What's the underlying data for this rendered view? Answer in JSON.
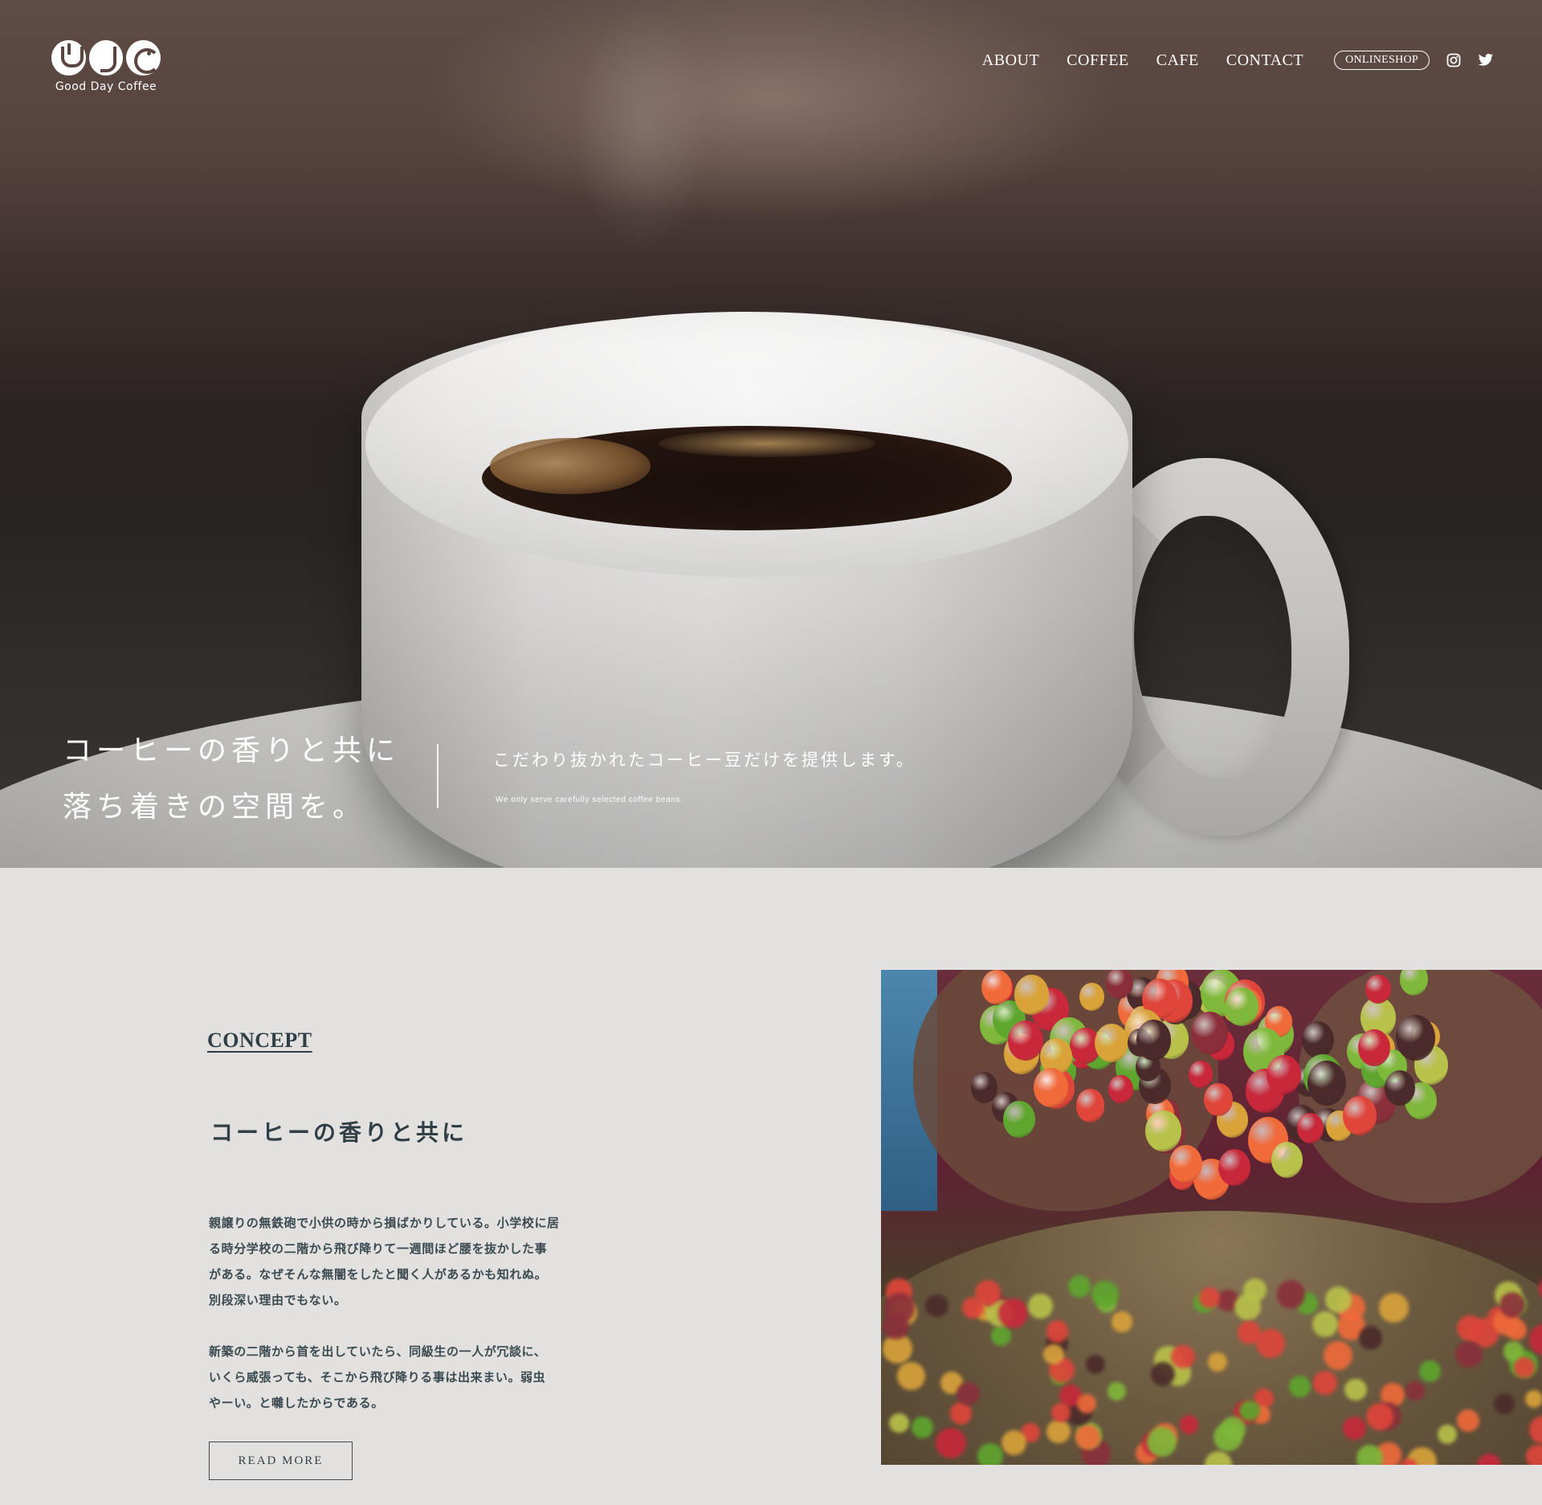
{
  "brand": {
    "name": "Good Day Coffee"
  },
  "nav": {
    "links": [
      "ABOUT",
      "COFFEE",
      "CAFE",
      "CONTACT"
    ],
    "shop_label": "ONLINESHOP",
    "icons": [
      "instagram-icon",
      "twitter-icon"
    ]
  },
  "hero": {
    "title_lines": [
      "コーヒーの香りと共に",
      "落ち着きの空間を。"
    ],
    "subtitle": "こだわり抜かれたコーヒー豆だけを提供します。",
    "subtitle_en": "We only serve carefully selected coffee beans."
  },
  "concept": {
    "label": "CONCEPT",
    "heading": "コーヒーの香りと共に",
    "paragraphs": [
      [
        "親譲りの無鉄砲で小供の時から損ばかりしている。小学校に居",
        "る時分学校の二階から飛び降りて一週間ほど腰を抜かした事",
        "がある。なぜそんな無闇をしたと聞く人があるかも知れぬ。",
        "別段深い理由でもない。"
      ],
      [
        "新築の二階から首を出していたら、同級生の一人が冗談に、",
        "いくら威張っても、そこから飛び降りる事は出来まい。弱虫",
        "やーい。と囃したからである。"
      ]
    ],
    "read_more": "READ MORE"
  },
  "colors": {
    "background": "#e3e1df",
    "text": "#2f3f45",
    "hero_text": "#ffffff"
  }
}
